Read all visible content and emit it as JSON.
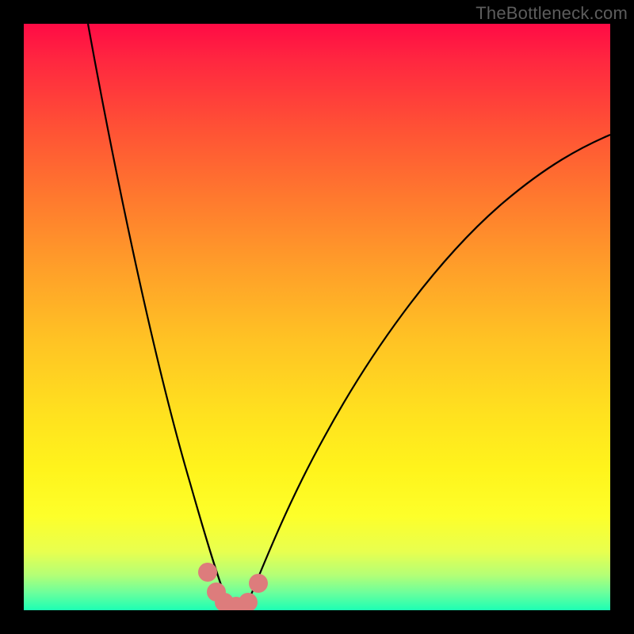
{
  "attribution": "TheBottleneck.com",
  "colors": {
    "background": "#000000",
    "gradient_top": "#ff0b45",
    "gradient_bottom": "#1cffb4",
    "curve_stroke": "#000000",
    "marker_fill": "#dd7c7c"
  },
  "chart_data": {
    "type": "line",
    "title": "",
    "xlabel": "",
    "ylabel": "",
    "xlim": [
      0,
      100
    ],
    "ylim": [
      0,
      100
    ],
    "grid": false,
    "note": "V-shaped bottleneck curve; axes unlabeled in source image; x/y values estimated from pixel positions on a 0–100 normalized grid",
    "series": [
      {
        "name": "left-branch",
        "x": [
          11,
          14,
          17,
          20,
          23,
          26,
          28,
          30,
          31.5,
          33,
          34
        ],
        "y": [
          100,
          82,
          66,
          51,
          38,
          26,
          17,
          10,
          6,
          3,
          1.7
        ]
      },
      {
        "name": "right-branch",
        "x": [
          38,
          40,
          43,
          47,
          52,
          58,
          65,
          73,
          82,
          92,
          100
        ],
        "y": [
          1.7,
          4,
          10,
          19,
          30,
          42,
          53,
          63,
          71,
          77,
          81
        ]
      },
      {
        "name": "valley-floor",
        "x": [
          34,
          35.5,
          36.5,
          38
        ],
        "y": [
          1.7,
          0.9,
          0.9,
          1.7
        ]
      }
    ],
    "markers": [
      {
        "name": "left-top-blob",
        "x": 31.3,
        "y": 6.5,
        "r": 1.6
      },
      {
        "name": "left-mid-blob",
        "x": 32.8,
        "y": 3.1,
        "r": 1.6
      },
      {
        "name": "left-bottom-blob",
        "x": 34.2,
        "y": 1.3,
        "r": 1.6
      },
      {
        "name": "center-blob",
        "x": 36.2,
        "y": 0.7,
        "r": 1.6
      },
      {
        "name": "right-bottom-blob",
        "x": 38.3,
        "y": 1.4,
        "r": 1.6
      },
      {
        "name": "right-top-blob",
        "x": 40.0,
        "y": 4.6,
        "r": 1.6
      }
    ]
  }
}
